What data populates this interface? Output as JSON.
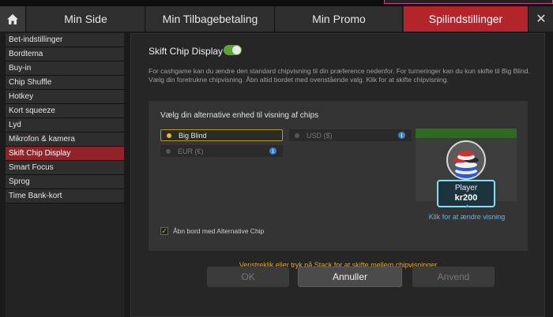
{
  "colors": {
    "accent_red": "#b3242b",
    "sidebar_active": "#8f2329",
    "toggle_on": "#5aa632",
    "link_blue": "#59b8f0",
    "hint_orange": "#e0a63a",
    "selected_border": "#b8962e"
  },
  "tabs": [
    {
      "label": "Min Side"
    },
    {
      "label": "Min Tilbagebetaling"
    },
    {
      "label": "Min Promo"
    },
    {
      "label": "Spilindstillinger",
      "active": true
    }
  ],
  "icons": {
    "home": "home-icon",
    "close": "close-icon",
    "info": "info-icon",
    "check": "check-icon"
  },
  "close_label": "✕",
  "sidebar": {
    "items": [
      {
        "label": "Bet-indstillinger"
      },
      {
        "label": "Bordtema"
      },
      {
        "label": "Buy-in"
      },
      {
        "label": "Chip Shuffle"
      },
      {
        "label": "Hotkey"
      },
      {
        "label": "Kort squeeze"
      },
      {
        "label": "Lyd"
      },
      {
        "label": "Mikrofon & kamera"
      },
      {
        "label": "Skift Chip Display",
        "active": true
      },
      {
        "label": "Smart Focus"
      },
      {
        "label": "Sprog"
      },
      {
        "label": "Time Bank-kort"
      }
    ]
  },
  "main": {
    "title": "Skift Chip Display",
    "toggle_on": true,
    "description": "For cashgame kan du ændre den standard chipvisning til din præference nedenfor. For turneringer kan du kun skifte til Big Blind. Vælg din foretrukne chipvisning. Åbn altid bordet med ovenstående valg. Klik for at skifte chipvisning.",
    "panel": {
      "title": "Vælg din alternative enhed til visning af chips",
      "options": {
        "big_blind": "Big Blind",
        "usd": "USD ($)",
        "eur": "EUR (€)"
      },
      "selected": "Big Blind",
      "checkbox_label": "Åbn bord med Alternative Chip",
      "checkbox_checked": true,
      "preview": {
        "player_name": "Player",
        "amount": "kr200"
      },
      "change_link": "Klik for at ændre visning",
      "hint": "Venstreklik eller tryk på Stack for at skifte mellem chipvisninger"
    },
    "buttons": {
      "ok": "OK",
      "cancel": "Annuller",
      "apply": "Anvend"
    }
  }
}
